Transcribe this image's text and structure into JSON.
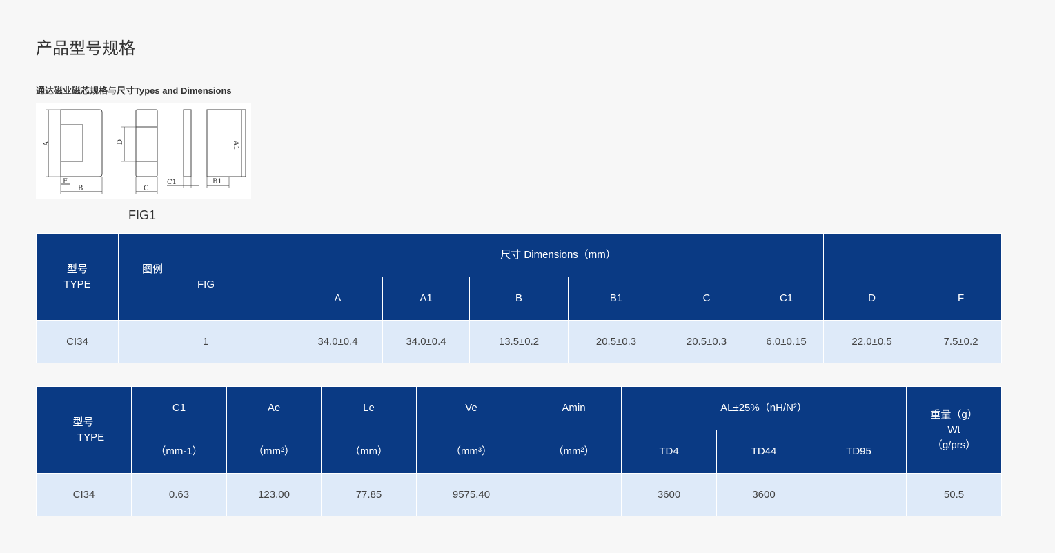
{
  "page": {
    "title": "产品型号规格",
    "subtitle": "通达磁业磁芯规格与尺寸Types and Dimensions",
    "fig_caption": "FIG1"
  },
  "figure": {
    "labels": [
      "A",
      "F",
      "B",
      "D",
      "C",
      "C1",
      "A1",
      "B1"
    ]
  },
  "table1": {
    "type_cn": "型号",
    "type_en": "TYPE",
    "fig_cn": "图例",
    "fig_en": "FIG",
    "dimensions_header": "尺寸  Dimensions（mm）",
    "columns": [
      "A",
      "A1",
      "B",
      "B1",
      "C",
      "C1",
      "D",
      "F"
    ],
    "rows": [
      {
        "type": "CI34",
        "fig": "1",
        "values": [
          "34.0±0.4",
          "34.0±0.4",
          "13.5±0.2",
          "20.5±0.3",
          "20.5±0.3",
          "6.0±0.15",
          "22.0±0.5",
          "7.5±0.2"
        ]
      }
    ]
  },
  "table2": {
    "type_cn": "型号",
    "type_en": "TYPE",
    "params": [
      {
        "name": "C1",
        "unit": "（mm-1）"
      },
      {
        "name": "Ae",
        "unit": "（mm²）"
      },
      {
        "name": "Le",
        "unit": "（mm）"
      },
      {
        "name": "Ve",
        "unit": "（mm³）"
      },
      {
        "name": "Amin",
        "unit": "（mm²）"
      }
    ],
    "al_header": "AL±25%（nH/N²）",
    "al_columns": [
      "TD4",
      "TD44",
      "TD95"
    ],
    "weight_cn": "重量（g）",
    "weight_en": "Wt",
    "weight_unit": "（g/prs）",
    "rows": [
      {
        "type": "CI34",
        "values": [
          "0.63",
          "123.00",
          "77.85",
          "9575.40",
          "",
          "3600",
          "3600",
          "",
          "50.5"
        ]
      }
    ]
  }
}
